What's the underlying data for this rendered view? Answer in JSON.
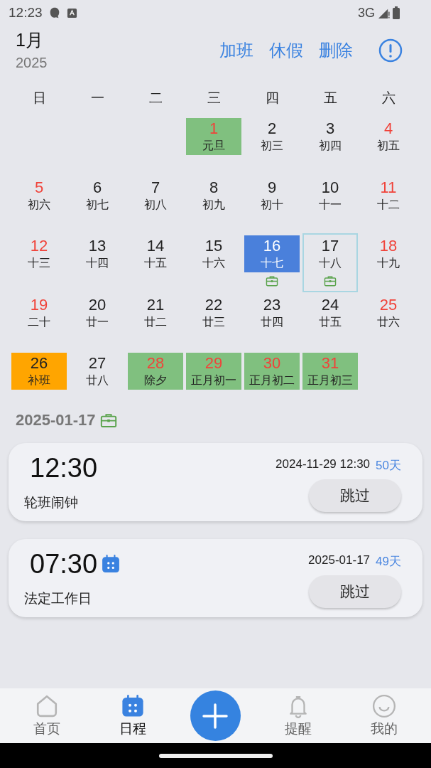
{
  "status_bar": {
    "time": "12:23",
    "network": "3G"
  },
  "header": {
    "month": "1月",
    "year": "2025",
    "actions": [
      "加班",
      "休假",
      "删除"
    ]
  },
  "weekdays": [
    "日",
    "一",
    "二",
    "三",
    "四",
    "五",
    "六"
  ],
  "days": [
    {
      "kind": "blank"
    },
    {
      "kind": "blank"
    },
    {
      "kind": "blank"
    },
    {
      "kind": "holiday",
      "day": "1",
      "lunar": "元旦",
      "red": true,
      "selected": false,
      "shift": false
    },
    {
      "kind": "normal",
      "day": "2",
      "lunar": "初三",
      "red": false,
      "selected": false,
      "shift": false
    },
    {
      "kind": "normal",
      "day": "3",
      "lunar": "初四",
      "red": false,
      "selected": false,
      "shift": false
    },
    {
      "kind": "normal",
      "day": "4",
      "lunar": "初五",
      "red": true,
      "selected": false,
      "shift": false
    },
    {
      "kind": "normal",
      "day": "5",
      "lunar": "初六",
      "red": true,
      "selected": false,
      "shift": false
    },
    {
      "kind": "normal",
      "day": "6",
      "lunar": "初七",
      "red": false,
      "selected": false,
      "shift": false
    },
    {
      "kind": "normal",
      "day": "7",
      "lunar": "初八",
      "red": false,
      "selected": false,
      "shift": false
    },
    {
      "kind": "normal",
      "day": "8",
      "lunar": "初九",
      "red": false,
      "selected": false,
      "shift": false
    },
    {
      "kind": "normal",
      "day": "9",
      "lunar": "初十",
      "red": false,
      "selected": false,
      "shift": false
    },
    {
      "kind": "normal",
      "day": "10",
      "lunar": "十一",
      "red": false,
      "selected": false,
      "shift": false
    },
    {
      "kind": "normal",
      "day": "11",
      "lunar": "十二",
      "red": true,
      "selected": false,
      "shift": false
    },
    {
      "kind": "normal",
      "day": "12",
      "lunar": "十三",
      "red": true,
      "selected": false,
      "shift": false
    },
    {
      "kind": "normal",
      "day": "13",
      "lunar": "十四",
      "red": false,
      "selected": false,
      "shift": false
    },
    {
      "kind": "normal",
      "day": "14",
      "lunar": "十五",
      "red": false,
      "selected": false,
      "shift": false
    },
    {
      "kind": "normal",
      "day": "15",
      "lunar": "十六",
      "red": false,
      "selected": false,
      "shift": false
    },
    {
      "kind": "today",
      "day": "16",
      "lunar": "十七",
      "red": false,
      "selected": false,
      "shift": true
    },
    {
      "kind": "normal",
      "day": "17",
      "lunar": "十八",
      "red": false,
      "selected": true,
      "shift": true
    },
    {
      "kind": "normal",
      "day": "18",
      "lunar": "十九",
      "red": true,
      "selected": false,
      "shift": false
    },
    {
      "kind": "normal",
      "day": "19",
      "lunar": "二十",
      "red": true,
      "selected": false,
      "shift": false
    },
    {
      "kind": "normal",
      "day": "20",
      "lunar": "廿一",
      "red": false,
      "selected": false,
      "shift": false
    },
    {
      "kind": "normal",
      "day": "21",
      "lunar": "廿二",
      "red": false,
      "selected": false,
      "shift": false
    },
    {
      "kind": "normal",
      "day": "22",
      "lunar": "廿三",
      "red": false,
      "selected": false,
      "shift": false
    },
    {
      "kind": "normal",
      "day": "23",
      "lunar": "廿四",
      "red": false,
      "selected": false,
      "shift": false
    },
    {
      "kind": "normal",
      "day": "24",
      "lunar": "廿五",
      "red": false,
      "selected": false,
      "shift": false
    },
    {
      "kind": "normal",
      "day": "25",
      "lunar": "廿六",
      "red": true,
      "selected": false,
      "shift": false
    },
    {
      "kind": "makeup",
      "day": "26",
      "lunar": "补班",
      "red": false,
      "selected": false,
      "shift": false
    },
    {
      "kind": "normal",
      "day": "27",
      "lunar": "廿八",
      "red": false,
      "selected": false,
      "shift": false
    },
    {
      "kind": "holiday",
      "day": "28",
      "lunar": "除夕",
      "red": true,
      "selected": false,
      "shift": false
    },
    {
      "kind": "holiday",
      "day": "29",
      "lunar": "正月初一",
      "red": true,
      "selected": false,
      "shift": false
    },
    {
      "kind": "holiday",
      "day": "30",
      "lunar": "正月初二",
      "red": true,
      "selected": false,
      "shift": false
    },
    {
      "kind": "holiday",
      "day": "31",
      "lunar": "正月初三",
      "red": true,
      "selected": false,
      "shift": false
    }
  ],
  "selected_date": {
    "date": "2025-01-17",
    "shift": true
  },
  "alarms": [
    {
      "time": "12:30",
      "name": "轮班闹钟",
      "next": "2024-11-29 12:30",
      "days": "50天",
      "button": "跳过",
      "calendar": false
    },
    {
      "time": "07:30",
      "name": "法定工作日",
      "next": "2025-01-17",
      "days": "49天",
      "button": "跳过",
      "calendar": true
    }
  ],
  "nav": [
    {
      "label": "首页",
      "kind": "home",
      "selected": false
    },
    {
      "label": "日程",
      "kind": "schedule",
      "selected": true
    },
    {
      "kind": "add"
    },
    {
      "label": "提醒",
      "kind": "bell",
      "selected": false
    },
    {
      "label": "我的",
      "kind": "smile",
      "selected": false
    }
  ]
}
